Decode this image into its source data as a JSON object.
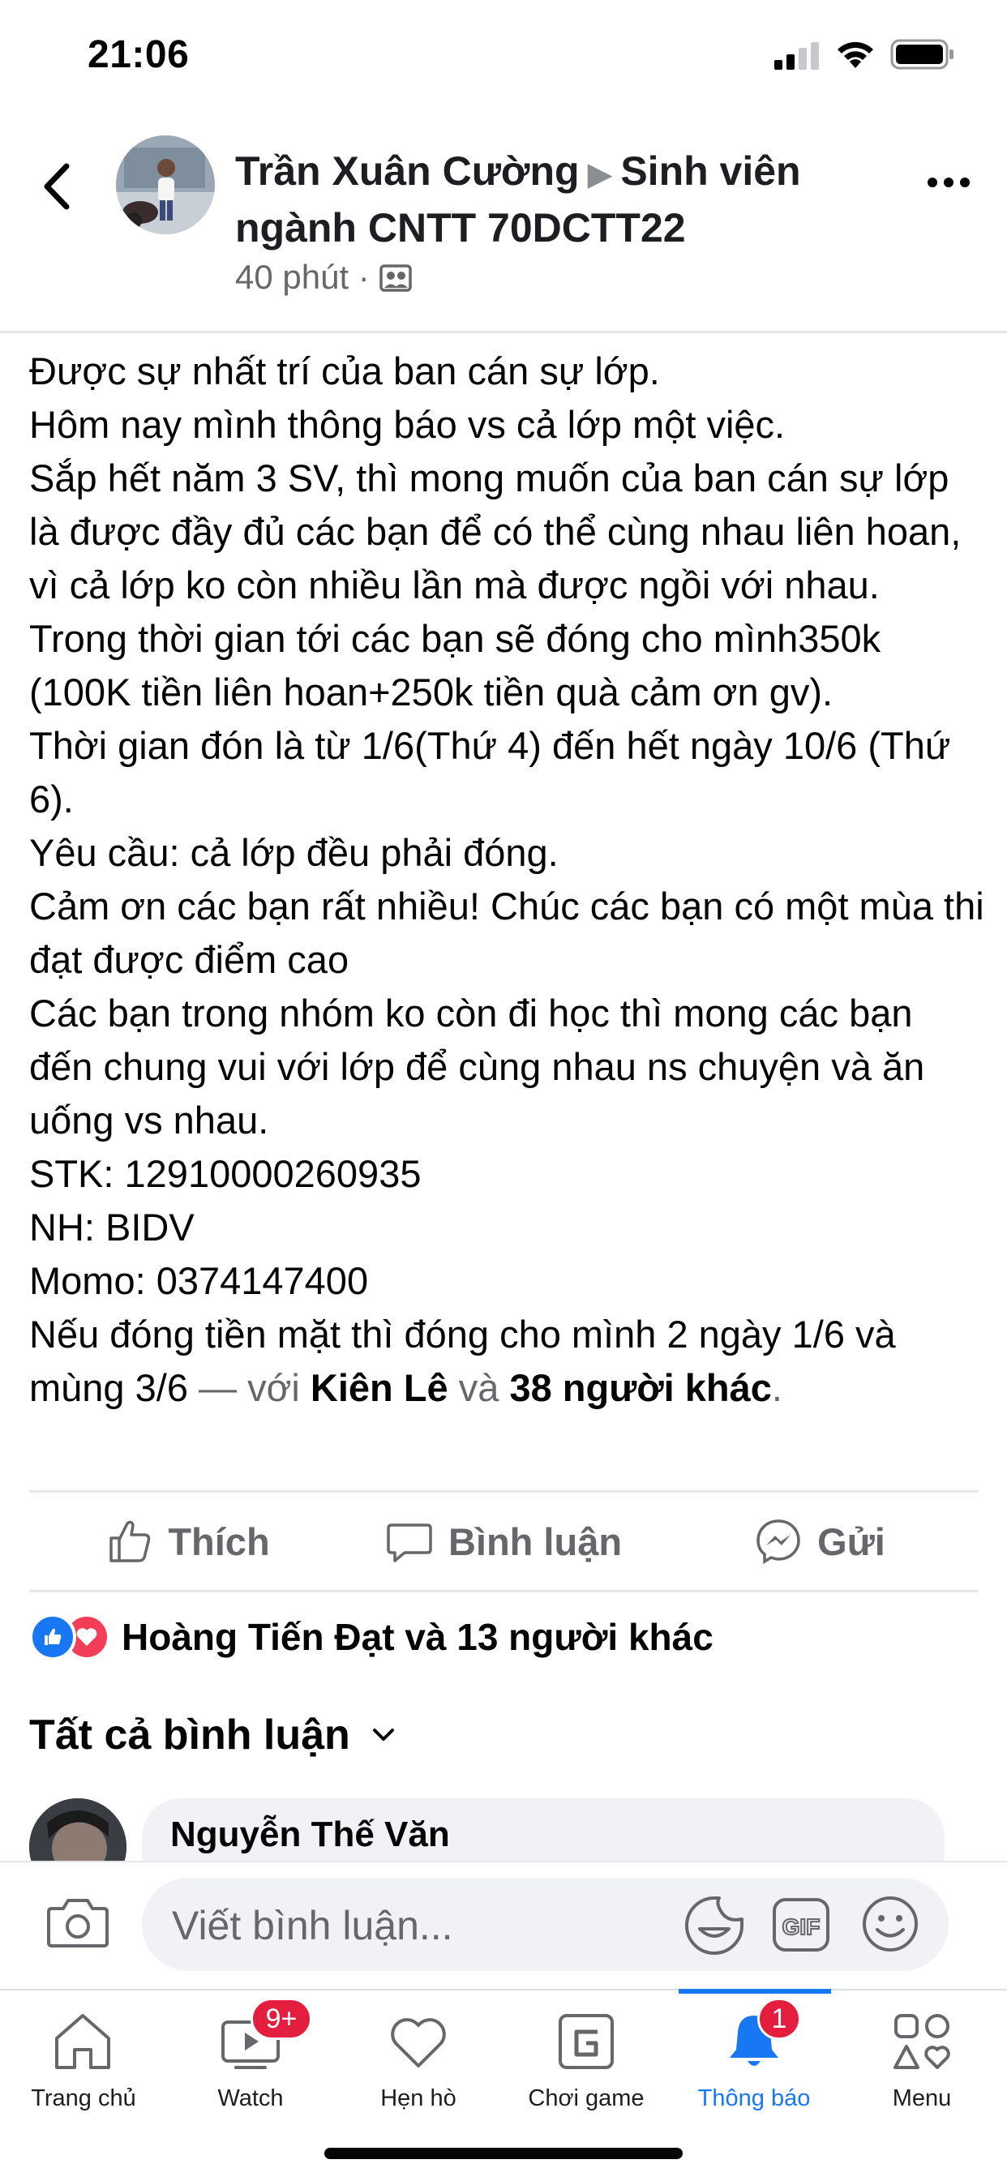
{
  "status_bar": {
    "time": "21:06"
  },
  "header": {
    "author": "Trần Xuân Cường",
    "group": "Sinh viên ngành CNTT 70DCTT22",
    "time": "40 phút ·"
  },
  "post": {
    "lines": [
      "Được sự nhất trí của ban cán sự lớp.",
      "Hôm nay mình thông báo vs cả lớp một việc.",
      "Sắp hết năm 3 SV, thì mong muốn của ban cán sự lớp là được đầy đủ các bạn để có thể cùng nhau liên hoan, vì cả lớp ko còn nhiều lần mà được ngồi với nhau.",
      "Trong thời gian tới các bạn sẽ đóng cho mình350k (100K tiền liên hoan+250k tiền quà cảm ơn gv).",
      "Thời gian đón là từ 1/6(Thứ 4) đến hết ngày 10/6 (Thứ 6).",
      "Yêu cầu: cả lớp đều phải đóng.",
      "Cảm ơn các bạn rất nhiều! Chúc các bạn có một mùa thi đạt được điểm cao",
      "Các bạn trong nhóm ko còn đi học thì mong các bạn đến chung vui với lớp để cùng nhau ns chuyện và ăn uống vs nhau.",
      "STK: 12910000260935",
      "NH: BIDV",
      "Momo: 0374147400"
    ],
    "last_line": "Nếu đóng tiền mặt thì đóng cho mình 2 ngày 1/6 và mùng 3/6",
    "with_text": " — với ",
    "tag_name": "Kiên Lê",
    "and_text": " và ",
    "others": "38 người khác",
    "period": "."
  },
  "actions": {
    "like": "Thích",
    "comment": "Bình luận",
    "send": "Gửi"
  },
  "reactions": {
    "summary": "Hoàng Tiến Đạt và 13 người khác"
  },
  "comments": {
    "title": "Tất cả bình luận",
    "first_author": "Nguyễn Thế Văn"
  },
  "composer": {
    "placeholder": "Viết bình luận..."
  },
  "tabs": [
    {
      "label": "Trang chủ",
      "icon": "home-icon"
    },
    {
      "label": "Watch",
      "icon": "watch-icon",
      "badge": "9+"
    },
    {
      "label": "Hẹn hò",
      "icon": "heart-icon"
    },
    {
      "label": "Chơi game",
      "icon": "gaming-icon"
    },
    {
      "label": "Thông báo",
      "icon": "bell-icon",
      "badge": "1",
      "active": true
    },
    {
      "label": "Menu",
      "icon": "menu-icon"
    }
  ],
  "colors": {
    "accent": "#1877f2",
    "badge": "#e41e3f",
    "love": "#f33e58",
    "muted": "#65676b"
  }
}
